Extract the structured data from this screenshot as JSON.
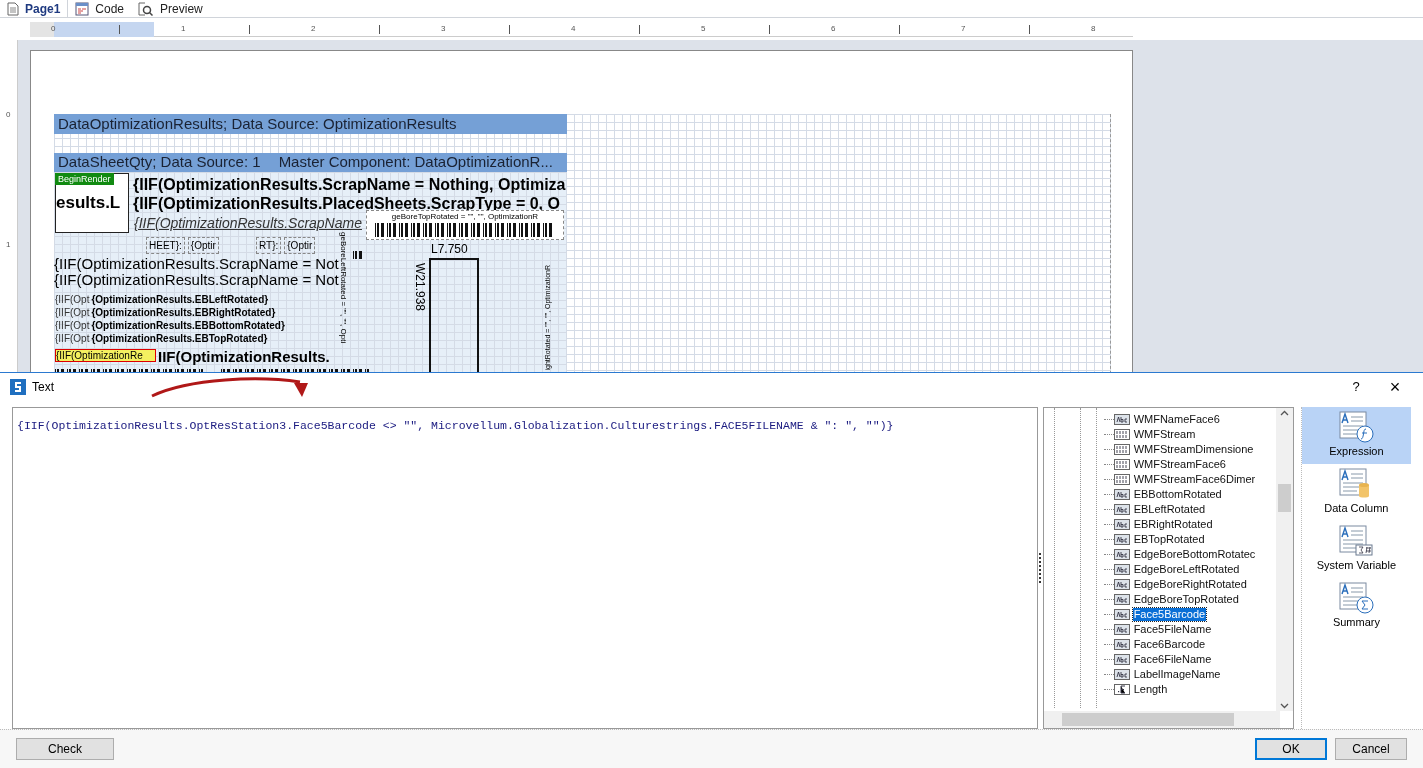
{
  "tabs": [
    {
      "label": "Page1",
      "selected": true
    },
    {
      "label": "Code",
      "selected": false
    },
    {
      "label": "Preview",
      "selected": false
    }
  ],
  "ruler": {
    "marks": [
      "0",
      "1",
      "2",
      "3",
      "4",
      "5",
      "6",
      "7",
      "8"
    ],
    "vertical_marks": [
      "0",
      "1"
    ]
  },
  "report": {
    "bands": [
      {
        "header": "DataOptimizationResults; Data Source: OptimizationResults"
      },
      {
        "header": "DataSheetQty; Data Source: 1",
        "master": "Master Component: DataOptimizationR..."
      }
    ],
    "begin_render": "BeginRender",
    "image_text": "esults.L",
    "bold_lines": [
      "{IIF(OptimizationResults.ScrapName = Nothing, Optimiza",
      "{IIF(OptimizationResults.PlacedSheets.ScrapType = 0, O"
    ],
    "italic_line": "{IIF(OptimizationResults.ScrapName",
    "barcode_top": "geBoreTopRotated = \"\", \"\", OptimizationR",
    "small_fields": [
      {
        "label": "HEET}:",
        "value": "{Optir"
      },
      {
        "label": "RT}:",
        "value": "{Optir"
      }
    ],
    "scrap_lines": [
      "{IIF(OptimizationResults.ScrapName = Not",
      "{IIF(OptimizationResults.ScrapName = Not"
    ],
    "edge_rows": [
      {
        "prefix": "{IIF(Opt",
        "field": "{OptimizationResults.EBLeftRotated}"
      },
      {
        "prefix": "{IIF(Opt",
        "field": "{OptimizationResults.EBRightRotated}"
      },
      {
        "prefix": "{IIF(Opt",
        "field": "{OptimizationResults.EBBottomRotated}"
      },
      {
        "prefix": "{IIF(Opt",
        "field": "{OptimizationResults.EBTopRotated}"
      }
    ],
    "selected_field": "{IIF(OptimizationRe",
    "next_field": "IIF(OptimizationResults.",
    "left_vertical": "geBoreLeftRotated = \"\", \"\", Opti",
    "right_vertical": "ightRotated = \"\", \"\", OptimizationR",
    "length": "L7.750",
    "width": "W21.938"
  },
  "dialog": {
    "title": "Text",
    "help": "?",
    "close": "×",
    "expression": "{IIF(OptimizationResults.OptResStation3.Face5Barcode <> \"\",  Microvellum.Globalization.Culturestrings.FACE5FILENAME & \": \", \"\")}",
    "tree": [
      {
        "label": "WMFNameFace6",
        "kind": "text",
        "selected": false
      },
      {
        "label": "WMFStream",
        "kind": "binary",
        "selected": false
      },
      {
        "label": "WMFStreamDimensione",
        "kind": "binary",
        "selected": false
      },
      {
        "label": "WMFStreamFace6",
        "kind": "binary",
        "selected": false
      },
      {
        "label": "WMFStreamFace6Dimer",
        "kind": "binary",
        "selected": false
      },
      {
        "label": "EBBottomRotated",
        "kind": "text",
        "selected": false
      },
      {
        "label": "EBLeftRotated",
        "kind": "text",
        "selected": false
      },
      {
        "label": "EBRightRotated",
        "kind": "text",
        "selected": false
      },
      {
        "label": "EBTopRotated",
        "kind": "text",
        "selected": false
      },
      {
        "label": "EdgeBoreBottomRotatec",
        "kind": "text",
        "selected": false
      },
      {
        "label": "EdgeBoreLeftRotated",
        "kind": "text",
        "selected": false
      },
      {
        "label": "EdgeBoreRightRotated",
        "kind": "text",
        "selected": false
      },
      {
        "label": "EdgeBoreTopRotated",
        "kind": "text",
        "selected": false
      },
      {
        "label": "Face5Barcode",
        "kind": "text",
        "selected": true
      },
      {
        "label": "Face5FileName",
        "kind": "text",
        "selected": false
      },
      {
        "label": "Face6Barcode",
        "kind": "text",
        "selected": false
      },
      {
        "label": "Face6FileName",
        "kind": "text",
        "selected": false
      },
      {
        "label": "LabelImageName",
        "kind": "text",
        "selected": false
      },
      {
        "label": "Length",
        "kind": "number",
        "selected": false
      }
    ],
    "modes": [
      {
        "label": "Expression",
        "kind": "expression",
        "selected": true
      },
      {
        "label": "Data Column",
        "kind": "column",
        "selected": false
      },
      {
        "label": "System Variable",
        "kind": "variable",
        "selected": false
      },
      {
        "label": "Summary",
        "kind": "summary",
        "selected": false
      }
    ],
    "check": "Check",
    "ok": "OK",
    "cancel": "Cancel"
  }
}
